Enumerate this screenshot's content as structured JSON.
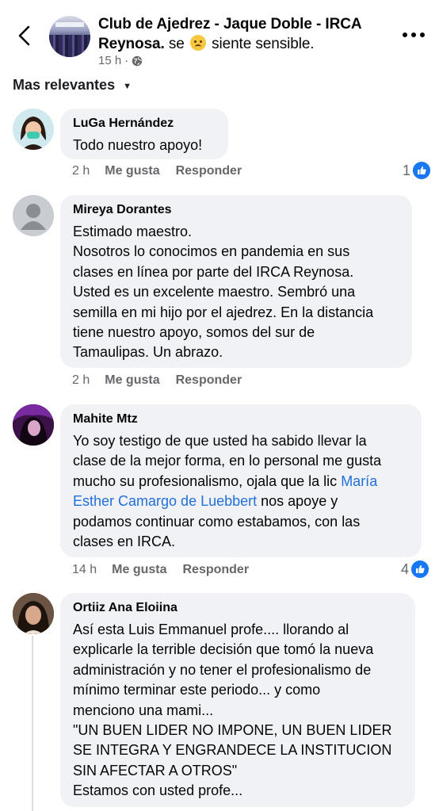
{
  "header": {
    "group_name": "Club de Ajedrez - Jaque Doble - IRCA Reynosa.",
    "feeling_prefix": " se",
    "feeling_text": " siente sensible.",
    "feeling_icon": "sad-face-emoji",
    "time": "15 h",
    "privacy_icon": "globe-icon"
  },
  "sort": {
    "label": "Mas relevantes"
  },
  "comments": [
    {
      "name": "LuGa Hernández",
      "lines": [
        "Todo nuestro apoyo!"
      ],
      "time": "2 h",
      "like": "Me gusta",
      "reply": "Responder",
      "reactions": "1"
    },
    {
      "name": "Mireya Dorantes",
      "lines": [
        "Estimado maestro.",
        "Nosotros lo conocimos en pandemia en sus",
        "clases en línea por parte del IRCA Reynosa.",
        "Usted es un excelente maestro. Sembró una",
        "semilla en mi hijo por el ajedrez. En la distancia",
        "tiene nuestro apoyo, somos del sur de",
        "Tamaulipas. Un abrazo."
      ],
      "time": "2 h",
      "like": "Me gusta",
      "reply": "Responder"
    },
    {
      "name": "Mahite Mtz",
      "line1": "Yo soy testigo de que usted ha sabido llevar la",
      "line2": "clase de la mejor forma, en lo personal me gusta",
      "line3_before": "mucho su profesionalismo, ojala que la lic ",
      "line3_link": "María",
      "line4_link": "Esther Camargo de Luebbert",
      "line4_after": " nos apoye y",
      "line5": "podamos continuar como estabamos, con las",
      "line6": "clases en IRCA.",
      "time": "14 h",
      "like": "Me gusta",
      "reply": "Responder",
      "reactions": "4"
    },
    {
      "name": "Ortiiz Ana Eloiina",
      "lines": [
        "Así esta Luis Emmanuel profe.... llorando al",
        "explicarle la terrible decisión que tomó la nueva",
        "administración y no tener el profesionalismo de",
        "mínimo terminar este periodo... y como",
        "menciono una mami...",
        "\"UN BUEN LIDER NO IMPONE, UN BUEN LIDER",
        "SE INTEGRA Y ENGRANDECE LA INSTITUCION",
        "SIN AFECTAR A OTROS\"",
        "Estamos con usted profe..."
      ]
    }
  ],
  "colors": {
    "like_blue": "#1877f2",
    "bubble": "#f0f2f5",
    "link": "#216fdb",
    "muted": "#65676b"
  }
}
